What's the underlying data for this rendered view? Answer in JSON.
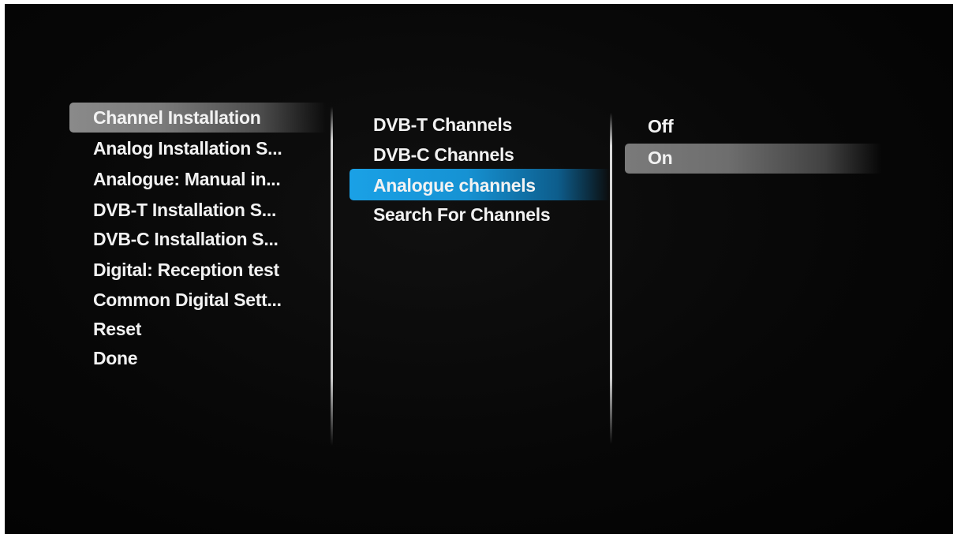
{
  "menu": {
    "main_items": [
      {
        "label": "Channel Installation"
      },
      {
        "label": "Analog Installation S..."
      },
      {
        "label": "Analogue: Manual in..."
      },
      {
        "label": "DVB-T Installation S..."
      },
      {
        "label": "DVB-C Installation S..."
      },
      {
        "label": "Digital: Reception test"
      },
      {
        "label": "Common Digital Sett..."
      },
      {
        "label": "Reset"
      },
      {
        "label": "Done"
      }
    ],
    "sub_items": [
      {
        "label": "DVB-T Channels"
      },
      {
        "label": "DVB-C Channels"
      },
      {
        "label": "Analogue channels"
      },
      {
        "label": "Search For Channels"
      }
    ],
    "options": [
      {
        "label": "Off"
      },
      {
        "label": "On"
      }
    ]
  },
  "colors": {
    "focus_highlight": "#1aa1e6",
    "selection_highlight": "#8a8a8a",
    "background": "#070707",
    "text": "#f2f2f2"
  }
}
